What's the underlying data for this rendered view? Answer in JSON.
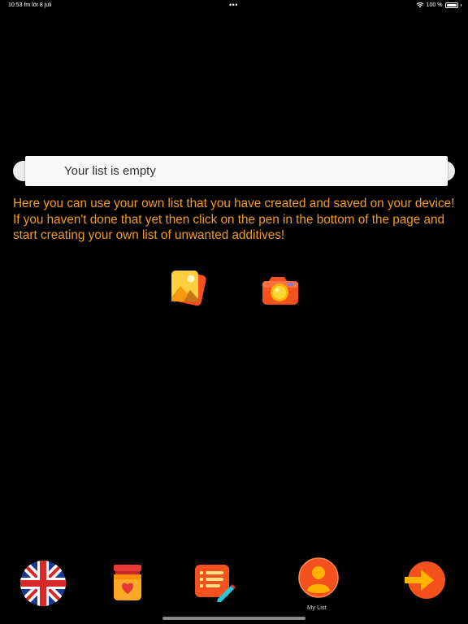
{
  "status_bar": {
    "time_date": "10:53 fm   lör 8 juli",
    "dots": "•••",
    "battery_text": "100 %"
  },
  "list": {
    "empty_text": "Your list is empty"
  },
  "info": {
    "text": "Here you can use your own list that you have created and saved on your device! If you haven't done that yet then click on the pen in the bottom of the page and start creating your own list of unwanted additives!"
  },
  "actions": {
    "gallery_icon": "photo-gallery-icon",
    "camera_icon": "camera-icon"
  },
  "tab_bar": {
    "items": [
      {
        "icon": "uk-flag-icon",
        "label": ""
      },
      {
        "icon": "jar-icon",
        "label": ""
      },
      {
        "icon": "pen-list-icon",
        "label": ""
      },
      {
        "icon": "person-icon",
        "label": "My List"
      },
      {
        "icon": "arrow-right-icon",
        "label": ""
      }
    ]
  },
  "colors": {
    "background": "#000000",
    "info_text": "#f39c1f",
    "accent_orange": "#f57c1f"
  }
}
